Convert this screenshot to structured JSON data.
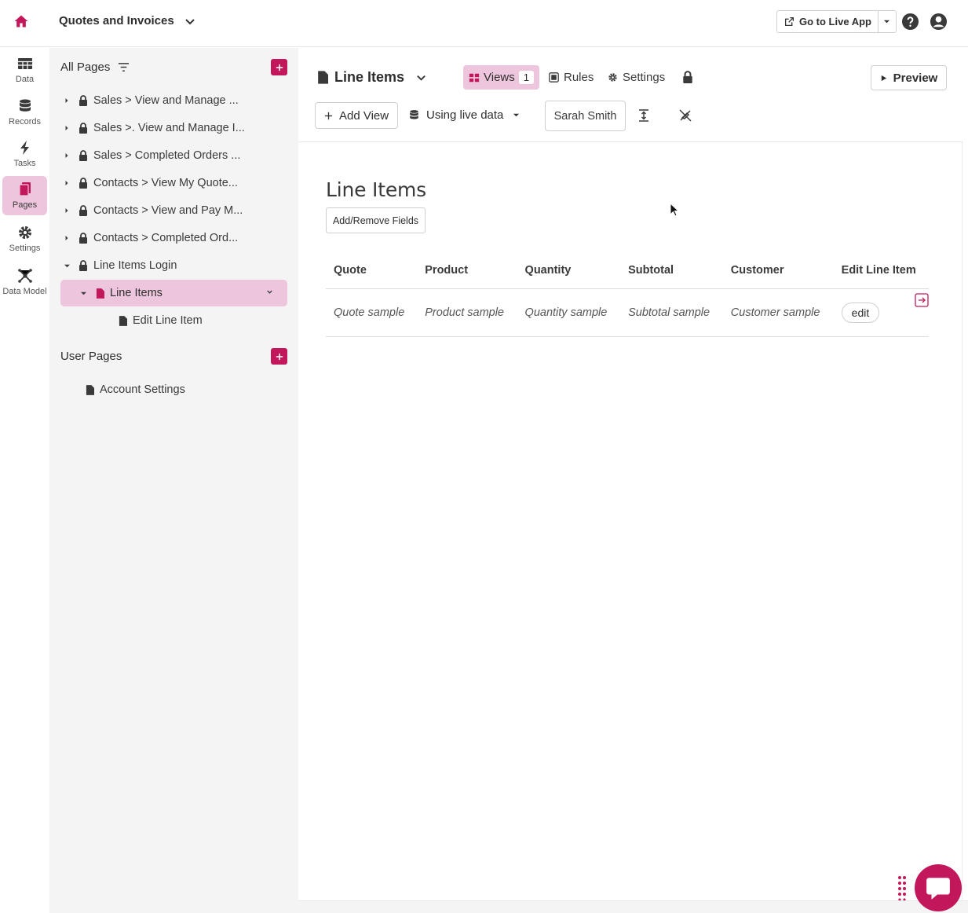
{
  "app": {
    "title": "Quotes and Invoices",
    "live_button": "Go to Live App",
    "accent": "#c2185b",
    "highlight": "#edc6dd"
  },
  "rail": {
    "items": [
      {
        "label": "Data",
        "icon": "table-icon"
      },
      {
        "label": "Records",
        "icon": "database-icon"
      },
      {
        "label": "Tasks",
        "icon": "bolt-icon"
      },
      {
        "label": "Pages",
        "icon": "pages-icon"
      },
      {
        "label": "Settings",
        "icon": "gear-icon"
      },
      {
        "label": "Data Model",
        "icon": "network-icon"
      }
    ]
  },
  "tree": {
    "all_pages_label": "All Pages",
    "user_pages_label": "User Pages",
    "items": [
      {
        "label": "Sales > View and Manage ..."
      },
      {
        "label": "Sales >. View and Manage I..."
      },
      {
        "label": "Sales > Completed Orders ..."
      },
      {
        "label": "Contacts > View My Quote..."
      },
      {
        "label": "Contacts > View and Pay M..."
      },
      {
        "label": "Contacts > Completed Ord..."
      },
      {
        "label": "Line Items Login"
      },
      {
        "label": "Line Items"
      },
      {
        "label": "Edit Line Item"
      }
    ],
    "user_items": [
      {
        "label": "Account Settings"
      }
    ]
  },
  "main": {
    "page_title": "Line Items",
    "views_label": "Views",
    "views_count": "1",
    "rules_label": "Rules",
    "settings_label": "Settings",
    "preview_label": "Preview",
    "add_view_label": "Add View",
    "live_data_label": "Using live data",
    "user_select": "Sarah Smith",
    "view": {
      "title": "Line Items",
      "fields_button": "Add/Remove Fields",
      "columns": [
        "Quote",
        "Product",
        "Quantity",
        "Subtotal",
        "Customer",
        "Edit Line Item"
      ],
      "row": [
        "Quote sample",
        "Product sample",
        "Quantity sample",
        "Subtotal sample",
        "Customer sample"
      ],
      "edit_label": "edit"
    }
  }
}
